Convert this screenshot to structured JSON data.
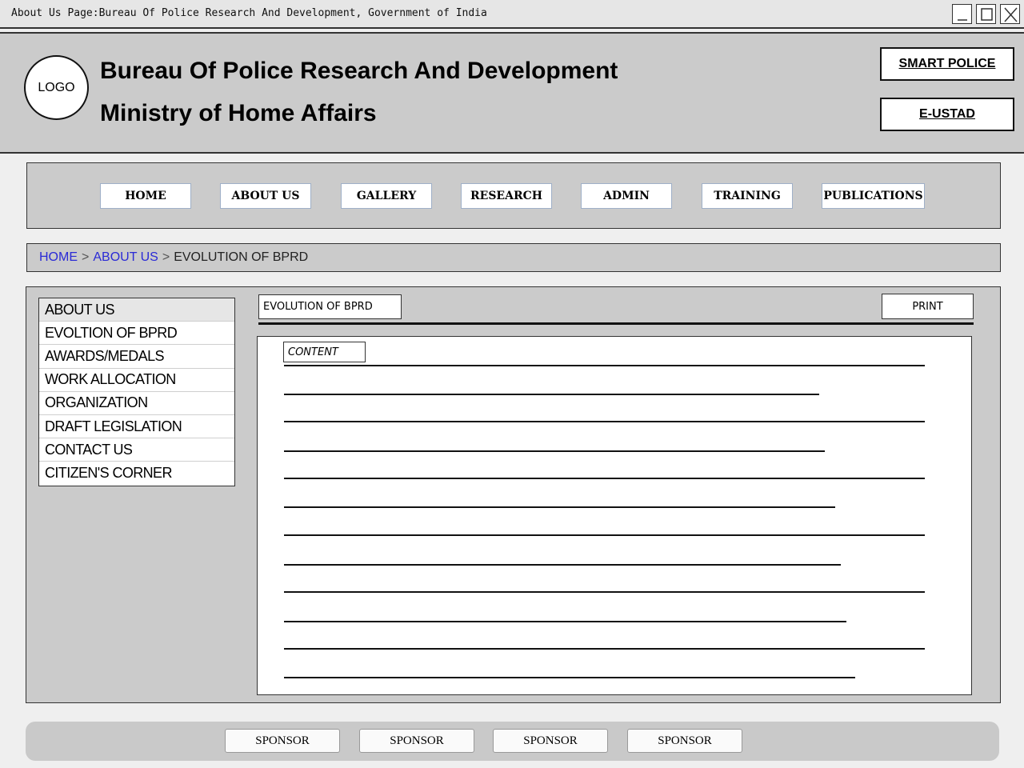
{
  "window": {
    "title": "About Us Page:Bureau Of Police Research And Development, Government of India"
  },
  "header": {
    "logo_text": "LOGO",
    "org_name": "Bureau Of Police Research And Development",
    "ministry": "Ministry of Home Affairs",
    "links": [
      "SMART POLICE",
      "E-USTAD"
    ]
  },
  "nav": {
    "items": [
      "HOME",
      "ABOUT US",
      "GALLERY",
      "RESEARCH",
      "ADMIN",
      "TRAINING",
      "PUBLICATIONS"
    ]
  },
  "breadcrumb": {
    "home": "HOME",
    "about": "ABOUT US",
    "sep": ">",
    "current": "EVOLUTION OF BPRD"
  },
  "sidebar": {
    "heading": "ABOUT US",
    "items": [
      "EVOLTION OF BPRD",
      "AWARDS/MEDALS",
      "WORK ALLOCATION",
      "ORGANIZATION",
      "DRAFT LEGISLATION",
      "CONTACT US",
      "CITIZEN'S CORNER"
    ]
  },
  "content": {
    "title": "EVOLUTION OF BPRD",
    "print_label": "PRINT",
    "label": "CONTENT"
  },
  "footer": {
    "sponsors": [
      "SPONSOR",
      "SPONSOR",
      "SPONSOR",
      "SPONSOR"
    ]
  }
}
